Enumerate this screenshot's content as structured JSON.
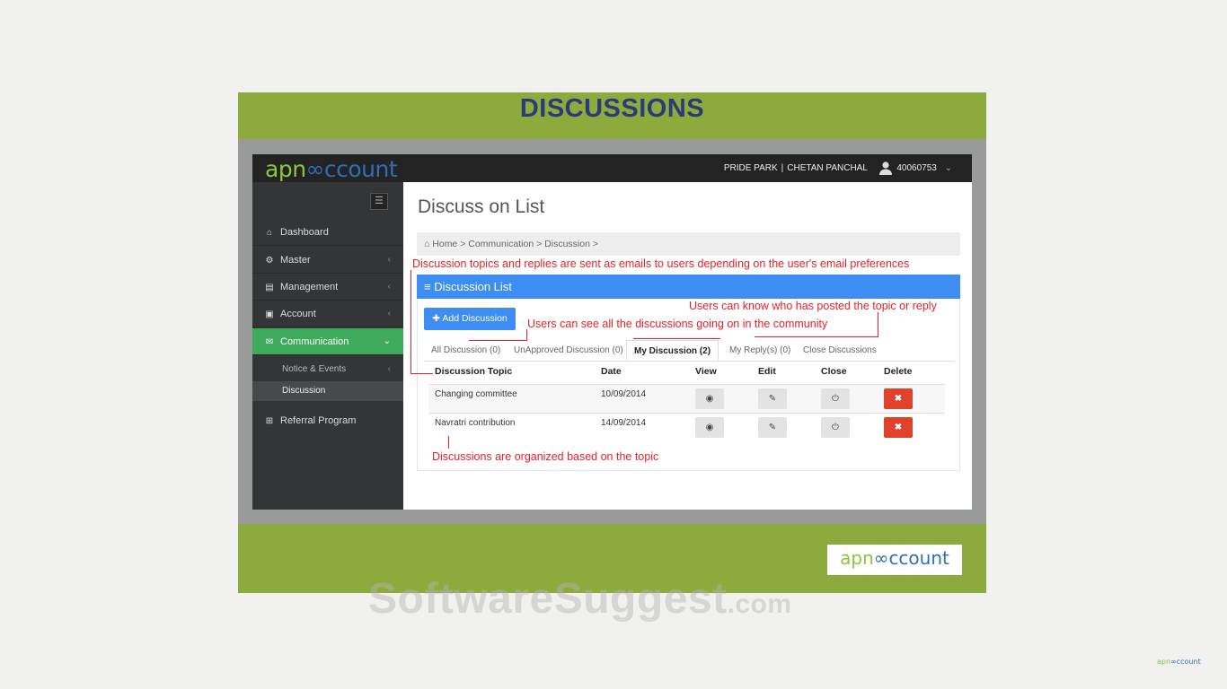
{
  "slide": {
    "title": "DISCUSSIONS"
  },
  "app": {
    "logo": {
      "part1": "apn",
      "part2": "ccount"
    },
    "topbar": {
      "society": "PRIDE PARK",
      "separator": "|",
      "user_name": "CHETAN PANCHAL",
      "user_id": "40060753"
    }
  },
  "sidebar": {
    "toggle_icon": "menu-icon",
    "items": [
      {
        "label": "Dashboard",
        "icon": "home-icon",
        "chevron": ""
      },
      {
        "label": "Master",
        "icon": "cogs-icon",
        "chevron": "‹"
      },
      {
        "label": "Management",
        "icon": "book-icon",
        "chevron": "‹"
      },
      {
        "label": "Account",
        "icon": "money-icon",
        "chevron": "‹"
      },
      {
        "label": "Communication",
        "icon": "chat-icon",
        "chevron": "⌄"
      },
      {
        "label": "Referral Program",
        "icon": "sitemap-icon",
        "chevron": ""
      }
    ],
    "subitems": [
      {
        "label": "Notice & Events",
        "chevron": "‹"
      },
      {
        "label": "Discussion",
        "chevron": ""
      }
    ]
  },
  "page": {
    "title": "Discuss on List",
    "breadcrumb": "Home > Communication > Discussion >",
    "panel_title": "≡ Discussion List",
    "add_button": "Add Discussion",
    "tabs": [
      "All Discussion (0)",
      "UnApproved Discussion (0)",
      "My Discussion (2)",
      "My Reply(s) (0)",
      "Close Discussions"
    ],
    "table": {
      "headers": [
        "Discussion Topic",
        "Date",
        "View",
        "Edit",
        "Close",
        "Delete"
      ],
      "rows": [
        {
          "topic": "Changing committee",
          "date": "10/09/2014"
        },
        {
          "topic": "Navratri contribution",
          "date": "14/09/2014"
        }
      ]
    }
  },
  "annotations": {
    "emails": "Discussion topics and replies are sent as emails to users depending on the user's email preferences",
    "posted": "Users can know who has posted the topic or reply",
    "all": "Users can see all the discussions going on in the community",
    "organized": "Discussions are organized based on the topic"
  },
  "footer_logo": {
    "part1": "apn",
    "part2": "ccount"
  },
  "watermark": {
    "main": "SoftwareSuggest",
    "tld": ".com"
  },
  "colors": {
    "slide_green": "#8cab3c",
    "title_navy": "#2d3a78",
    "primary_blue": "#3d8df3",
    "active_green": "#3eaa5c",
    "annotation_red": "#e8202a",
    "delete_red": "#e0412a"
  }
}
